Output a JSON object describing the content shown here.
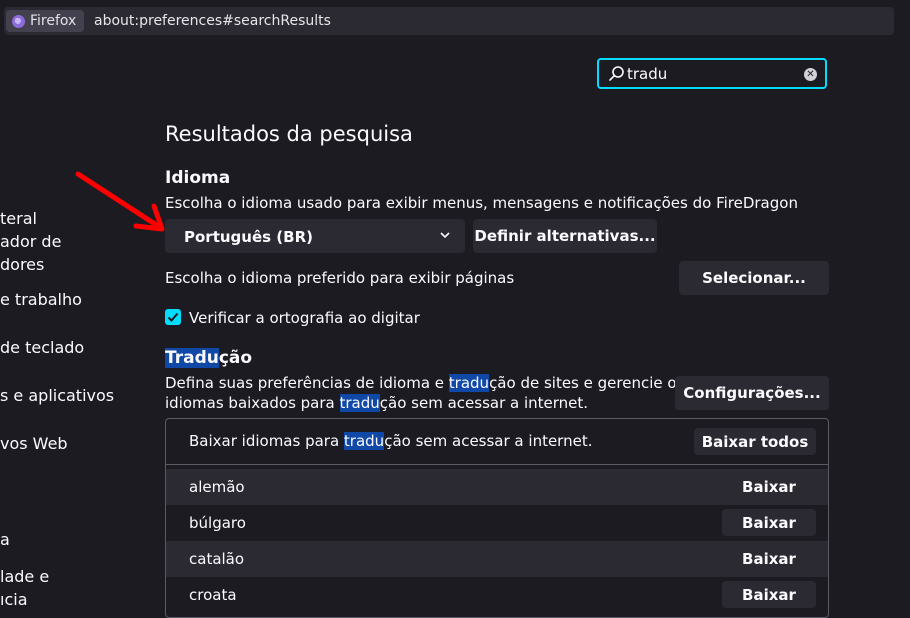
{
  "browser": {
    "identity_label": "Firefox",
    "url": "about:preferences#searchResults"
  },
  "sidebar": {
    "items": [
      {
        "label": "teral"
      },
      {
        "label": "ador de"
      },
      {
        "label": "dores"
      },
      {
        "label": "e trabalho"
      },
      {
        "label": "de teclado"
      },
      {
        "label": "s e aplicativos"
      },
      {
        "label": "vos Web"
      },
      {
        "label": "a"
      },
      {
        "label": "lade e"
      },
      {
        "label": "ıcia"
      }
    ]
  },
  "search": {
    "value": "tradu"
  },
  "results": {
    "title": "Resultados da pesquisa",
    "language": {
      "heading": "Idioma",
      "description": "Escolha o idioma usado para exibir menus, mensagens e notificações do FireDragon",
      "selected_language": "Português (BR)",
      "alternatives_button": "Definir alternativas...",
      "pages_description": "Escolha o idioma preferido para exibir páginas",
      "select_button": "Selecionar...",
      "spellcheck_label": "Verificar a ortografia ao digitar",
      "spellcheck_checked": true
    },
    "translation": {
      "heading_highlight": "Tradu",
      "heading_rest": "ção",
      "desc_line1_a": "Defina suas preferências de idioma e ",
      "desc_line1_hl": "tradu",
      "desc_line1_b": "ção de sites e gerencie os",
      "desc_line2_a": "idiomas baixados para ",
      "desc_line2_hl": "tradu",
      "desc_line2_b": "ção sem acessar a internet.",
      "settings_button": "Configurações...",
      "table_header_a": "Baixar idiomas para ",
      "table_header_hl": "tradu",
      "table_header_b": "ção sem acessar a internet.",
      "download_all_button": "Baixar todos",
      "languages": [
        {
          "name": "alemão",
          "button": "Baixar"
        },
        {
          "name": "búlgaro",
          "button": "Baixar"
        },
        {
          "name": "catalão",
          "button": "Baixar"
        },
        {
          "name": "croata",
          "button": "Baixar"
        }
      ]
    }
  },
  "colors": {
    "background": "#1c1b22",
    "button": "#2b2a33",
    "accent": "#00ddff",
    "highlight": "#1048a8",
    "annotation_arrow": "#ff0000"
  }
}
